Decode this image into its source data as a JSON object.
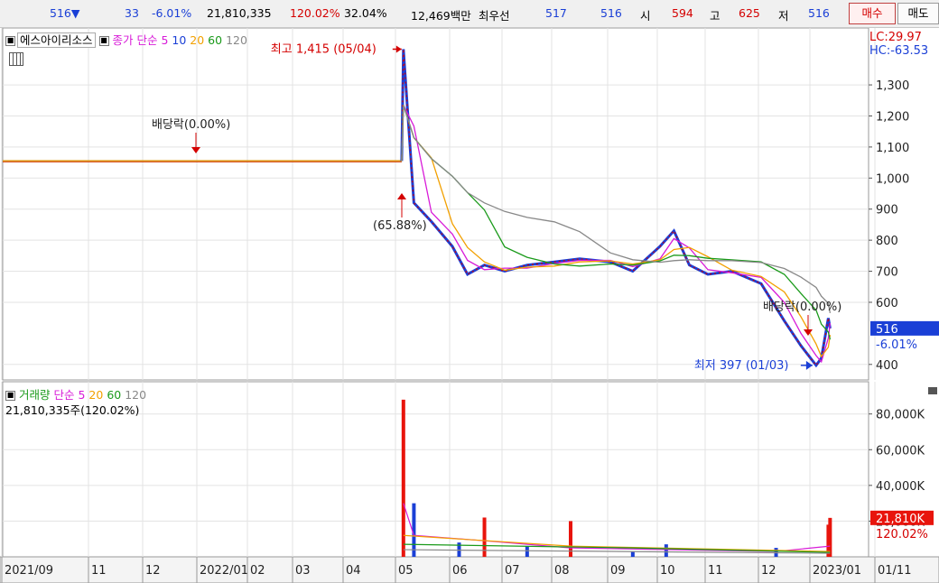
{
  "quote": {
    "price": "516",
    "price_arrow": "▼",
    "change": "33",
    "change_pct": "-6.01%",
    "volume": "21,810,335",
    "volume_ratio": "120.02%",
    "turnover": "32.04%",
    "amount": "12,469백만",
    "best_bid_label": "최우선",
    "best_ask": "517",
    "best_bid": "516",
    "open_label": "시",
    "open": "594",
    "high_label": "고",
    "high": "625",
    "low_label": "저",
    "low": "516",
    "buy_label": "매수",
    "sell_label": "매도"
  },
  "price_panel": {
    "name": "에스아이리소스",
    "ma_label": "종가 단순",
    "ma_periods": [
      "5",
      "10",
      "20",
      "60",
      "120"
    ],
    "ma_colors": [
      "#d81bd8",
      "#1a3fd6",
      "#f2a000",
      "#1a9a1a",
      "#888888"
    ],
    "lc": "LC:29.97",
    "hc": "HC:-63.53",
    "max_label": "최고 1,415 (05/04)",
    "min_label": "최저 397 (01/03)",
    "dividend1": "배당락(0.00%)",
    "dividend2": "배당락(0.00%)",
    "gap_label": "(65.88%)",
    "current_price": "516",
    "current_change": "-6.01%",
    "y_ticks": [
      "1,300",
      "1,200",
      "1,100",
      "1,000",
      "900",
      "800",
      "700",
      "600",
      "400"
    ]
  },
  "volume_panel": {
    "title": "거래량",
    "ma_label": "단순",
    "ma_periods": [
      "5",
      "20",
      "60",
      "120"
    ],
    "ma_colors": [
      "#d81bd8",
      "#f2a000",
      "#1a9a1a",
      "#888888"
    ],
    "current_info": "21,810,335주(120.02%)",
    "current_volume": "21,810K",
    "current_ratio": "120.02%",
    "y_ticks": [
      "80,000K",
      "60,000K",
      "40,000K",
      "20,000K"
    ]
  },
  "x_axis": [
    "2021/09",
    "11",
    "12",
    "2022/01",
    "02",
    "03",
    "04",
    "05",
    "06",
    "07",
    "08",
    "09",
    "10",
    "11",
    "12",
    "2023/01",
    "01/11"
  ],
  "chart_data": [
    {
      "type": "line",
      "title": "에스아이리소스",
      "x": [
        "2021/09",
        "2021/10",
        "2021/11",
        "2021/12",
        "2022/01",
        "2022/02",
        "2022/03",
        "2022/04",
        "2022/05/03",
        "2022/05/04",
        "2022/05/10",
        "2022/05/20",
        "2022/06/01",
        "2022/06/10",
        "2022/06/20",
        "2022/07/01",
        "2022/07/15",
        "2022/08/01",
        "2022/08/15",
        "2022/09/01",
        "2022/09/15",
        "2022/10/01",
        "2022/10/10",
        "2022/10/20",
        "2022/11/01",
        "2022/11/15",
        "2022/12/01",
        "2022/12/15",
        "2022/12/25",
        "2023/01/03",
        "2023/01/06",
        "2023/01/10",
        "2023/01/11"
      ],
      "series": [
        {
          "values": [
            1055,
            1055,
            1055,
            1055,
            1055,
            1055,
            1055,
            1055,
            1055,
            1415,
            920,
            860,
            780,
            690,
            720,
            700,
            720,
            730,
            740,
            730,
            700,
            780,
            830,
            720,
            690,
            700,
            660,
            540,
            460,
            397,
            420,
            549,
            516
          ]
        }
      ],
      "ylim": [
        350,
        1460
      ]
    },
    {
      "type": "bar",
      "title": "거래량",
      "x": [
        "2022/05/04",
        "2022/05/10",
        "2022/06/05",
        "2022/06/20",
        "2022/07/15",
        "2022/08/10",
        "2022/09/15",
        "2022/10/05",
        "2022/12/10",
        "2023/01/10",
        "2023/01/11"
      ],
      "values": [
        88000,
        30000,
        8000,
        22000,
        6000,
        20000,
        3000,
        7000,
        5000,
        18000,
        21810
      ],
      "ylim": [
        0,
        94000
      ]
    }
  ]
}
